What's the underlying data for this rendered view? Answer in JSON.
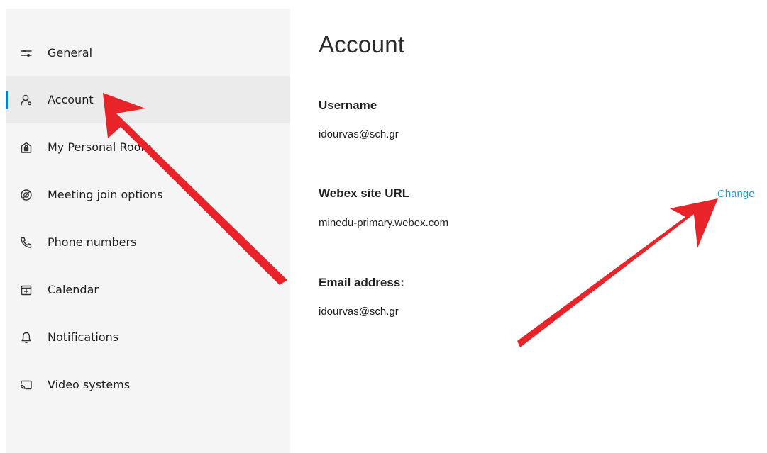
{
  "sidebar": {
    "items": [
      {
        "label": "General",
        "icon": "sliders-icon",
        "active": false
      },
      {
        "label": "Account",
        "icon": "user-gear-icon",
        "active": true
      },
      {
        "label": "My Personal Room",
        "icon": "room-lock-icon",
        "active": false
      },
      {
        "label": "Meeting join options",
        "icon": "meeting-join-icon",
        "active": false
      },
      {
        "label": "Phone numbers",
        "icon": "phone-icon",
        "active": false
      },
      {
        "label": "Calendar",
        "icon": "calendar-add-icon",
        "active": false
      },
      {
        "label": "Notifications",
        "icon": "bell-icon",
        "active": false
      },
      {
        "label": "Video systems",
        "icon": "cast-screen-icon",
        "active": false
      }
    ]
  },
  "main": {
    "title": "Account",
    "username": {
      "label": "Username",
      "value": "idourvas@sch.gr"
    },
    "site_url": {
      "label": "Webex site URL",
      "value": "minedu-primary.webex.com",
      "change_label": "Change"
    },
    "email": {
      "label": "Email address:",
      "value": "idourvas@sch.gr"
    }
  },
  "colors": {
    "accent": "#1a9ad6",
    "active_indicator": "#0a7fc2",
    "annotation_arrow": "#e8242a"
  }
}
